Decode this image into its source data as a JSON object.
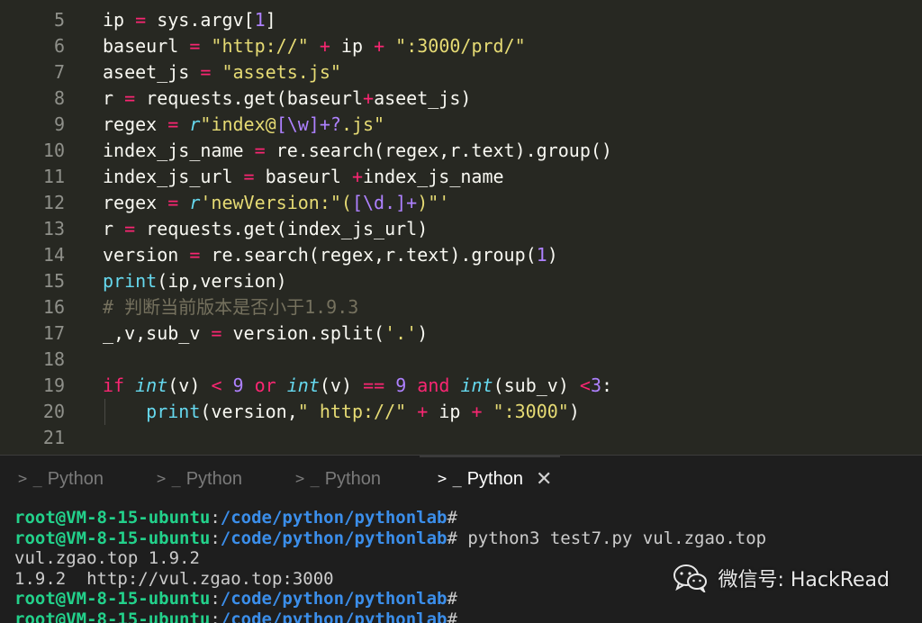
{
  "editor": {
    "lines": [
      {
        "num": "5",
        "tokens": [
          [
            "plain",
            "ip "
          ],
          [
            "op",
            "="
          ],
          [
            "plain",
            " sys.argv["
          ],
          [
            "num",
            "1"
          ],
          [
            "plain",
            "]"
          ]
        ]
      },
      {
        "num": "6",
        "tokens": [
          [
            "plain",
            "baseurl "
          ],
          [
            "op",
            "="
          ],
          [
            "plain",
            " "
          ],
          [
            "str",
            "\"http://\""
          ],
          [
            "plain",
            " "
          ],
          [
            "op",
            "+"
          ],
          [
            "plain",
            " ip "
          ],
          [
            "op",
            "+"
          ],
          [
            "plain",
            " "
          ],
          [
            "str",
            "\":3000/prd/\""
          ]
        ]
      },
      {
        "num": "7",
        "tokens": [
          [
            "plain",
            "aseet_js "
          ],
          [
            "op",
            "="
          ],
          [
            "plain",
            " "
          ],
          [
            "str",
            "\"assets.js\""
          ]
        ]
      },
      {
        "num": "8",
        "tokens": [
          [
            "plain",
            "r "
          ],
          [
            "op",
            "="
          ],
          [
            "plain",
            " requests.get(baseurl"
          ],
          [
            "op",
            "+"
          ],
          [
            "plain",
            "aseet_js)"
          ]
        ]
      },
      {
        "num": "9",
        "tokens": [
          [
            "plain",
            "regex "
          ],
          [
            "op",
            "="
          ],
          [
            "plain",
            " "
          ],
          [
            "prefix",
            "r"
          ],
          [
            "str",
            "\"index@"
          ],
          [
            "esc",
            "[\\w]+?"
          ],
          [
            "str",
            ".js\""
          ]
        ]
      },
      {
        "num": "10",
        "tokens": [
          [
            "plain",
            "index_js_name "
          ],
          [
            "op",
            "="
          ],
          [
            "plain",
            " re.search(regex,r.text).group()"
          ]
        ]
      },
      {
        "num": "11",
        "tokens": [
          [
            "plain",
            "index_js_url "
          ],
          [
            "op",
            "="
          ],
          [
            "plain",
            " baseurl "
          ],
          [
            "op",
            "+"
          ],
          [
            "plain",
            "index_js_name"
          ]
        ]
      },
      {
        "num": "12",
        "tokens": [
          [
            "plain",
            "regex "
          ],
          [
            "op",
            "="
          ],
          [
            "plain",
            " "
          ],
          [
            "prefix",
            "r"
          ],
          [
            "str",
            "'newVersion:\"("
          ],
          [
            "esc",
            "[\\d.]+"
          ],
          [
            "str",
            ")\"'"
          ]
        ]
      },
      {
        "num": "13",
        "tokens": [
          [
            "plain",
            "r "
          ],
          [
            "op",
            "="
          ],
          [
            "plain",
            " requests.get(index_js_url)"
          ]
        ]
      },
      {
        "num": "14",
        "tokens": [
          [
            "plain",
            "version "
          ],
          [
            "op",
            "="
          ],
          [
            "plain",
            " re.search(regex,r.text).group("
          ],
          [
            "num",
            "1"
          ],
          [
            "plain",
            ")"
          ]
        ]
      },
      {
        "num": "15",
        "tokens": [
          [
            "fn",
            "print"
          ],
          [
            "plain",
            "(ip,version)"
          ]
        ]
      },
      {
        "num": "16",
        "tokens": [
          [
            "comment",
            "# 判断当前版本是否小于1.9.3"
          ]
        ]
      },
      {
        "num": "17",
        "tokens": [
          [
            "plain",
            "_,v,sub_v "
          ],
          [
            "op",
            "="
          ],
          [
            "plain",
            " version.split("
          ],
          [
            "str",
            "'.'"
          ],
          [
            "plain",
            ")"
          ]
        ]
      },
      {
        "num": "18",
        "tokens": []
      },
      {
        "num": "19",
        "tokens": [
          [
            "kw",
            "if"
          ],
          [
            "plain",
            " "
          ],
          [
            "type",
            "int"
          ],
          [
            "plain",
            "(v) "
          ],
          [
            "op",
            "<"
          ],
          [
            "plain",
            " "
          ],
          [
            "num",
            "9"
          ],
          [
            "plain",
            " "
          ],
          [
            "kw",
            "or"
          ],
          [
            "plain",
            " "
          ],
          [
            "type",
            "int"
          ],
          [
            "plain",
            "(v) "
          ],
          [
            "op",
            "=="
          ],
          [
            "plain",
            " "
          ],
          [
            "num",
            "9"
          ],
          [
            "plain",
            " "
          ],
          [
            "kw",
            "and"
          ],
          [
            "plain",
            " "
          ],
          [
            "type",
            "int"
          ],
          [
            "plain",
            "(sub_v) "
          ],
          [
            "op",
            "<"
          ],
          [
            "num",
            "3"
          ],
          [
            "plain",
            ":"
          ]
        ]
      },
      {
        "num": "20",
        "indent": true,
        "tokens": [
          [
            "plain",
            "    "
          ],
          [
            "fn",
            "print"
          ],
          [
            "plain",
            "(version,"
          ],
          [
            "str",
            "\" http://\""
          ],
          [
            "plain",
            " "
          ],
          [
            "op",
            "+"
          ],
          [
            "plain",
            " ip "
          ],
          [
            "op",
            "+"
          ],
          [
            "plain",
            " "
          ],
          [
            "str",
            "\":3000\""
          ],
          [
            "plain",
            ")"
          ]
        ]
      },
      {
        "num": "21",
        "tokens": []
      }
    ]
  },
  "terminal_tabs": [
    {
      "prompt": "> _",
      "label": "Python",
      "active": false
    },
    {
      "prompt": "> _",
      "label": "Python",
      "active": false
    },
    {
      "prompt": "> _",
      "label": "Python",
      "active": false
    },
    {
      "prompt": "> _",
      "label": "Python",
      "active": true,
      "close": "✕"
    }
  ],
  "terminal": {
    "lines": [
      [
        [
          "user",
          "root@VM-8-15-ubuntu"
        ],
        [
          "term",
          ":"
        ],
        [
          "path",
          "/code/python/pythonlab"
        ],
        [
          "term",
          "#"
        ]
      ],
      [
        [
          "user",
          "root@VM-8-15-ubuntu"
        ],
        [
          "term",
          ":"
        ],
        [
          "path",
          "/code/python/pythonlab"
        ],
        [
          "term",
          "# python3 test7.py vul.zgao.top"
        ]
      ],
      [
        [
          "term",
          "vul.zgao.top 1.9.2"
        ]
      ],
      [
        [
          "term",
          "1.9.2  http://vul.zgao.top:3000"
        ]
      ],
      [
        [
          "user",
          "root@VM-8-15-ubuntu"
        ],
        [
          "term",
          ":"
        ],
        [
          "path",
          "/code/python/pythonlab"
        ],
        [
          "term",
          "#"
        ]
      ],
      [
        [
          "user",
          "root@VM-8-15-ubuntu"
        ],
        [
          "term",
          ":"
        ],
        [
          "path",
          "/code/python/pythonlab"
        ],
        [
          "term",
          "#"
        ]
      ]
    ]
  },
  "watermark": {
    "icon": "wechat-icon",
    "text": "微信号: HackRead"
  },
  "colors": {
    "editor_bg": "#272822",
    "terminal_bg": "#1e1e1e",
    "user_green": "#23d18b",
    "path_blue": "#3b8eea"
  }
}
